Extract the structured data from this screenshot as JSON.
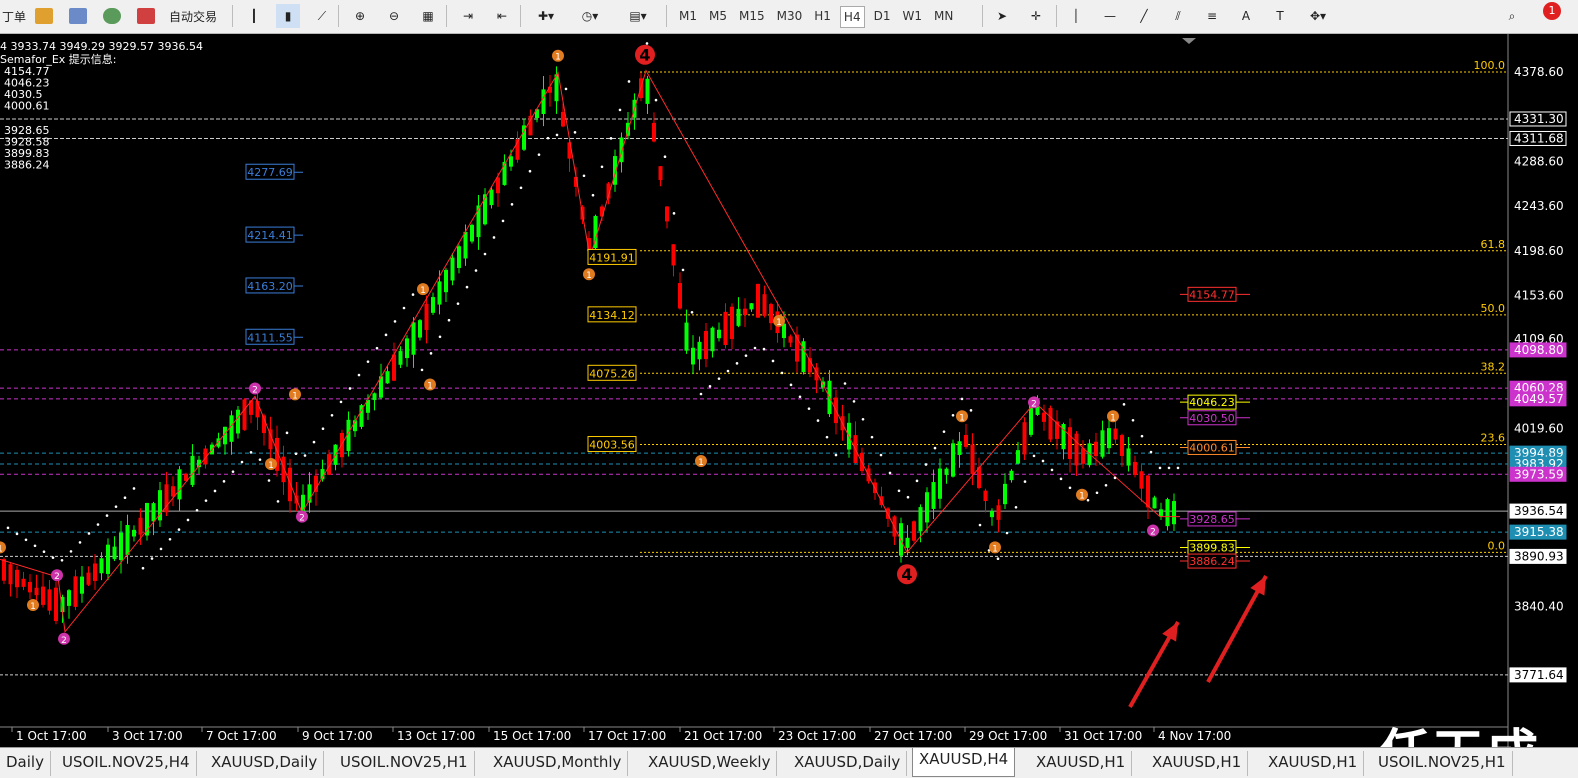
{
  "toolbar": {
    "menu_fragment": "丁单",
    "autotrade_label": "自动交易",
    "timeframes": [
      "M1",
      "M5",
      "M15",
      "M30",
      "H1",
      "H4",
      "D1",
      "W1",
      "MN"
    ],
    "active_timeframe": "H4",
    "alert_count": "1"
  },
  "chart": {
    "ohlc_header": "4  3933.74  3949.29  3929.57  3936.54",
    "indicator_title": "Semafor_Ex 提示信息:",
    "semafor_levels_top": [
      "4154.77",
      "4046.23",
      "4030.5",
      "4000.61"
    ],
    "semafor_levels_bottom": [
      "3928.65",
      "3928.58",
      "3899.83",
      "3886.24"
    ],
    "price_scale": [
      "4378.60",
      "4288.60",
      "4243.60",
      "4198.60",
      "4153.60",
      "4109.60",
      "4019.60",
      "3840.40"
    ],
    "price_markers": [
      {
        "text": "4331.30",
        "color": "#ffffff",
        "bg": "#000000"
      },
      {
        "text": "4311.68",
        "color": "#ffffff",
        "bg": "#000000"
      },
      {
        "text": "4098.80",
        "color": "#ffffff",
        "bg": "#cc33cc"
      },
      {
        "text": "4060.28",
        "color": "#ffffff",
        "bg": "#cc33cc"
      },
      {
        "text": "4049.57",
        "color": "#ffffff",
        "bg": "#cc33cc"
      },
      {
        "text": "3994.89",
        "color": "#ffffff",
        "bg": "#1e8fb3"
      },
      {
        "text": "3983.92",
        "color": "#ffffff",
        "bg": "#1e8fb3"
      },
      {
        "text": "3973.59",
        "color": "#ffffff",
        "bg": "#cc33cc"
      },
      {
        "text": "3936.54",
        "color": "#000000",
        "bg": "#ffffff"
      },
      {
        "text": "3915.38",
        "color": "#ffffff",
        "bg": "#1e8fb3"
      },
      {
        "text": "3890.93",
        "color": "#000000",
        "bg": "#ffffff"
      },
      {
        "text": "3771.64",
        "color": "#000000",
        "bg": "#ffffff"
      }
    ],
    "fib_levels": [
      "100.0",
      "61.8",
      "50.0",
      "38.2",
      "23.6",
      "0.0"
    ],
    "fib_price_labels": [
      "4191.91",
      "4134.12",
      "4075.26",
      "4003.56"
    ],
    "blue_labels": [
      "4277.69",
      "4214.41",
      "4163.20",
      "4111.55"
    ],
    "right_labels": [
      {
        "text": "4154.77",
        "color": "#ff3030"
      },
      {
        "text": "4046.23",
        "color": "#ffff00"
      },
      {
        "text": "4030.50",
        "color": "#cc33cc"
      },
      {
        "text": "4000.61",
        "color": "#ff8a2a"
      },
      {
        "text": "3928.65",
        "color": "#cc33cc"
      },
      {
        "text": "3899.83",
        "color": "#ffff00"
      },
      {
        "text": "3886.24",
        "color": "#ff3030"
      }
    ],
    "date_labels": [
      "1 Oct 17:00",
      "3 Oct 17:00",
      "7 Oct 17:00",
      "9 Oct 17:00",
      "13 Oct 17:00",
      "15 Oct 17:00",
      "17 Oct 17:00",
      "21 Oct 17:00",
      "23 Oct 17:00",
      "27 Oct 17:00",
      "29 Oct 17:00",
      "31 Oct 17:00",
      "4 Nov 17:00"
    ],
    "watermark": "任天成"
  },
  "tabs": [
    "Daily",
    "USOIL.NOV25,H4",
    "XAUUSD,Daily",
    "USOIL.NOV25,H1",
    "XAUUSD,Monthly",
    "XAUUSD,Weekly",
    "XAUUSD,Daily",
    "XAUUSD,H4",
    "XAUUSD,H1",
    "XAUUSD,H1",
    "XAUUSD,H1",
    "USOIL.NOV25,H1"
  ],
  "active_tab": "XAUUSD,H4",
  "colors": {
    "bull": "#00ff00",
    "bear": "#ff0000",
    "zigzag": "#ff2a2a",
    "fib": "#ffcc00",
    "sar": "#ffffff"
  }
}
